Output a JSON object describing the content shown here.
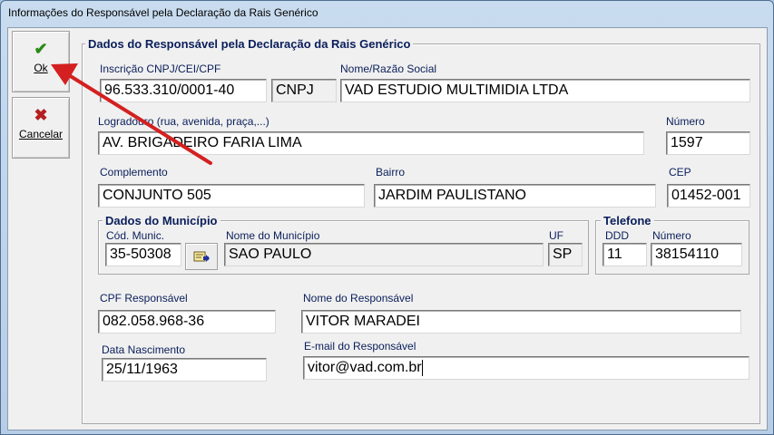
{
  "window": {
    "title": "Informações do Responsável pela Declaração da Rais Genérico"
  },
  "toolbar": {
    "ok": {
      "label": "Ok",
      "icon": "checkmark-icon"
    },
    "cancel": {
      "label": "Cancelar",
      "icon": "x-icon"
    }
  },
  "main_group": {
    "title": "Dados do Responsável pela Declaração da Rais Genérico",
    "inscricao": {
      "label": "Inscrição CNPJ/CEI/CPF",
      "value": "96.533.310/0001-40",
      "type_value": "CNPJ"
    },
    "nome": {
      "label": "Nome/Razão Social",
      "value": "VAD ESTUDIO MULTIMIDIA LTDA"
    },
    "logradouro": {
      "label": "Logradouro (rua, avenida, praça,...)",
      "value": "AV. BRIGADEIRO FARIA LIMA"
    },
    "numero": {
      "label": "Número",
      "value": "1597"
    },
    "complemento": {
      "label": "Complemento",
      "value": "CONJUNTO 505"
    },
    "bairro": {
      "label": "Bairro",
      "value": "JARDIM PAULISTANO"
    },
    "cep": {
      "label": "CEP",
      "value": "01452-001"
    }
  },
  "municipio": {
    "title": "Dados do Município",
    "cod_label": "Cód. Munic.",
    "cod_value": "35-50308",
    "nome_label": "Nome do Município",
    "nome_value": "SAO PAULO",
    "uf_label": "UF",
    "uf_value": "SP"
  },
  "telefone": {
    "title": "Telefone",
    "ddd_label": "DDD",
    "ddd_value": "11",
    "numero_label": "Número",
    "numero_value": "38154110"
  },
  "responsavel": {
    "cpf_label": "CPF Responsável",
    "cpf_value": "082.058.968-36",
    "nome_label": "Nome do Responsável",
    "nome_value": "VITOR MARADEI",
    "nascimento_label": "Data Nascimento",
    "nascimento_value": "25/11/1963",
    "email_label": "E-mail do Responsável",
    "email_value": "vitor@vad.com.br"
  },
  "annotation": {
    "color": "#d42020"
  }
}
